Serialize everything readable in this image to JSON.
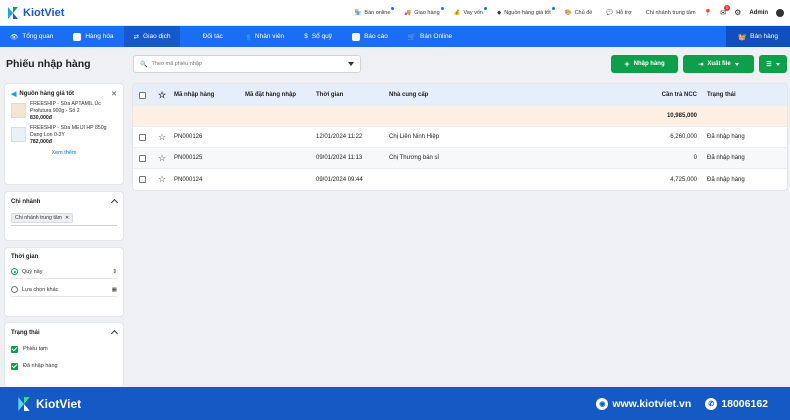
{
  "brand": {
    "name": "KiotViet"
  },
  "topbar": {
    "items": [
      {
        "label": "Bán online",
        "icon": "store-icon",
        "dot": true
      },
      {
        "label": "Giao hàng",
        "icon": "truck-icon",
        "dot": true
      },
      {
        "label": "Vay vốn",
        "icon": "money-icon",
        "dot": true
      },
      {
        "label": "Nguồn hàng giá tốt",
        "icon": "source-icon",
        "dot": true
      },
      {
        "label": "Chủ đề",
        "icon": "palette-icon",
        "dot": false
      },
      {
        "label": "Hỗ trợ",
        "icon": "chat-icon",
        "dot": false
      }
    ],
    "branch": "Chi nhánh trung tâm",
    "notif_count": "1",
    "user": "Admin"
  },
  "mainnav": {
    "items": [
      {
        "label": "Tổng quan",
        "icon": "eye-icon"
      },
      {
        "label": "Hàng hóa",
        "icon": "box-icon"
      },
      {
        "label": "Giao dịch",
        "icon": "exchange-icon"
      },
      {
        "label": "Đối tác",
        "icon": "partner-icon"
      },
      {
        "label": "Nhân viên",
        "icon": "staff-icon"
      },
      {
        "label": "Sổ quỹ",
        "icon": "fund-icon"
      },
      {
        "label": "Báo cáo",
        "icon": "report-icon"
      },
      {
        "label": "Bán Online",
        "icon": "cart-icon"
      }
    ],
    "active_index": 2,
    "sell_label": "Bán hàng"
  },
  "page": {
    "title": "Phiếu nhập hàng"
  },
  "search": {
    "placeholder": "Theo mã phiếu nhập"
  },
  "actions": {
    "import": "Nhập hàng",
    "export": "Xuất file"
  },
  "sidebar": {
    "promo": {
      "title": "Nguồn hàng giá tốt",
      "products": [
        {
          "name": "FREESHIP - Sữa APTAMIL Úc Profutura 900g - Số 2",
          "price": "830,000đ"
        },
        {
          "name": "FREESHIP - Sữa MEIJI HP 850g Dạng Lon 0-3Y",
          "price": "782,000đ"
        }
      ],
      "more": "Xem thêm"
    },
    "branch": {
      "title": "Chi nhánh",
      "chip": "Chi nhánh trung tâm"
    },
    "time": {
      "title": "Thời gian",
      "option1": "Quý này",
      "option2": "Lựa chọn khác"
    },
    "status": {
      "title": "Trạng thái",
      "options": [
        "Phiếu tạm",
        "Đã nhập hàng"
      ]
    }
  },
  "table": {
    "headers": {
      "code": "Mã nhập hàng",
      "order": "Mã đặt hàng nhập",
      "time": "Thời gian",
      "supplier": "Nhà cung cấp",
      "payable": "Cần trả NCC",
      "status": "Trạng thái"
    },
    "summary": {
      "payable": "10,985,000"
    },
    "rows": [
      {
        "code": "PN000126",
        "order": "",
        "time": "12/01/2024 11:22",
        "supplier": "Chị Liên Ninh Hiệp",
        "payable": "6,260,000",
        "status": "Đã nhập hàng"
      },
      {
        "code": "PN000125",
        "order": "",
        "time": "09/01/2024 11:13",
        "supplier": "Chị Thương bán sỉ",
        "payable": "0",
        "status": "Đã nhập hàng"
      },
      {
        "code": "PN000124",
        "order": "",
        "time": "09/01/2024 09:44",
        "supplier": "",
        "payable": "4,725,000",
        "status": "Đã nhập hàng"
      }
    ]
  },
  "footer": {
    "brand": "KiotViet",
    "website": "www.kiotviet.vn",
    "hotline": "18006162"
  },
  "colors": {
    "primary": "#1a6df5",
    "green": "#0e9f4a",
    "footer": "#1459c4"
  }
}
